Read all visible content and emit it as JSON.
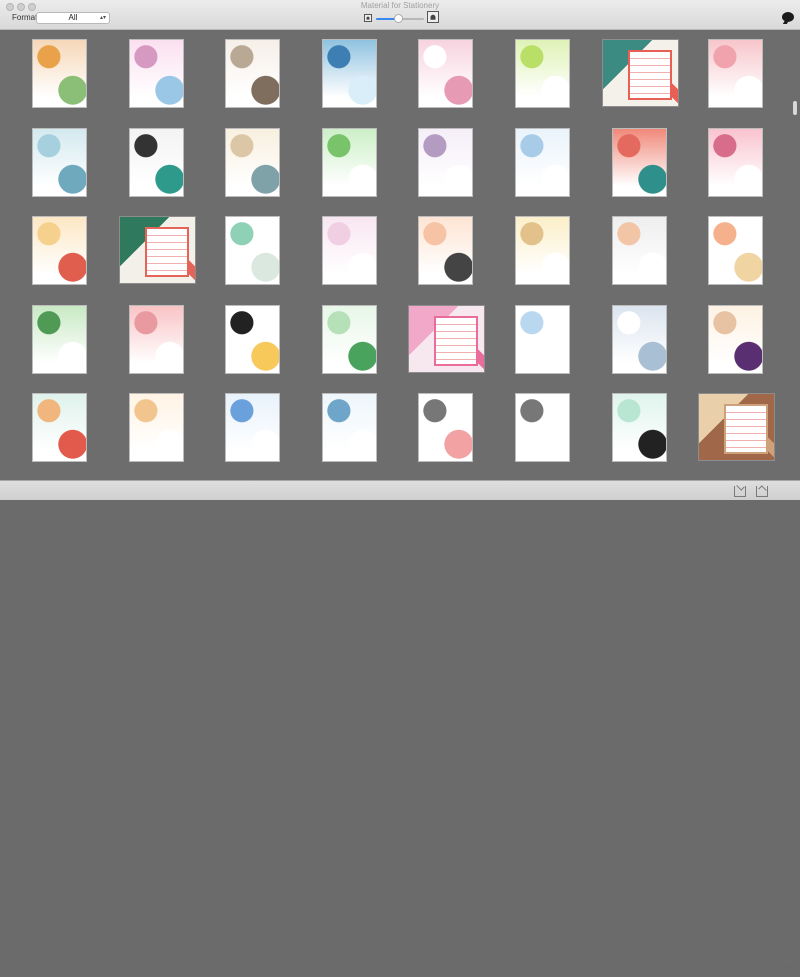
{
  "window": {
    "title": "Material for Stationery"
  },
  "toolbar": {
    "format_label": "Format:",
    "format_value": "All",
    "chat_icon": "chat-icon",
    "zoom_small_icon": "photo-small-icon",
    "zoom_large_icon": "photo-large-icon",
    "zoom_level": 0.45
  },
  "bottom_toolbar": {
    "icons": [
      "export-icon",
      "import-icon",
      "trash-icon"
    ]
  },
  "stationery": [
    {
      "id": 1,
      "theme": "floral-circle",
      "colors": [
        "#f6d7b7",
        "#e9a24a",
        "#8bbf77"
      ]
    },
    {
      "id": 2,
      "theme": "pink-floral-border",
      "colors": [
        "#fbe0f0",
        "#d69ac2",
        "#9bc7e6"
      ]
    },
    {
      "id": 3,
      "theme": "tea-pages",
      "colors": [
        "#f6efe8",
        "#b9a894",
        "#7f6d5d"
      ]
    },
    {
      "id": 4,
      "theme": "blue-strip",
      "colors": [
        "#8fc2e0",
        "#3d7fb3",
        "#d9eef9"
      ]
    },
    {
      "id": 5,
      "theme": "minimal-pink-dot",
      "colors": [
        "#f7d3df",
        "#ffffff",
        "#e69ab3"
      ]
    },
    {
      "id": 6,
      "theme": "green-daisies",
      "colors": [
        "#dff2b6",
        "#b9df67",
        "#ffffff"
      ]
    },
    {
      "id": 7,
      "theme": "teal-envelope",
      "colors": [
        "#3b8b82",
        "#e85f55",
        "#f4f0ea"
      ]
    },
    {
      "id": 8,
      "theme": "pink-blossom-corner",
      "colors": [
        "#f7c5cb",
        "#f0a2ad",
        "#ffffff"
      ]
    },
    {
      "id": 9,
      "theme": "sea-sky",
      "colors": [
        "#d3e9ef",
        "#a6d0de",
        "#6fa9be"
      ]
    },
    {
      "id": 10,
      "theme": "sketch-couple",
      "colors": [
        "#f3f3f3",
        "#333333",
        "#2e9a8b"
      ]
    },
    {
      "id": 11,
      "theme": "autumn-trees",
      "colors": [
        "#f8f0df",
        "#dbc7a6",
        "#7fa1a8"
      ]
    },
    {
      "id": 12,
      "theme": "green-vine-border",
      "colors": [
        "#ccefc7",
        "#79c36b",
        "#ffffff"
      ]
    },
    {
      "id": 13,
      "theme": "lavender-flowers",
      "colors": [
        "#f5eef8",
        "#b49bc2",
        "#ffffff"
      ]
    },
    {
      "id": 14,
      "theme": "blue-lined",
      "colors": [
        "#eaf3fb",
        "#a8cce8",
        "#ffffff"
      ]
    },
    {
      "id": 15,
      "theme": "salmon-block",
      "colors": [
        "#f0897a",
        "#e46a60",
        "#2f8f8a"
      ]
    },
    {
      "id": 16,
      "theme": "cherry-blossom",
      "colors": [
        "#f9c3cf",
        "#d76d8a",
        "#ffffff"
      ]
    },
    {
      "id": 17,
      "theme": "peach-lantern",
      "colors": [
        "#fde7c4",
        "#f6d08d",
        "#e05e4e"
      ]
    },
    {
      "id": 18,
      "theme": "green-envelope-card",
      "colors": [
        "#2f7a5e",
        "#e56458",
        "#f3f0ea"
      ]
    },
    {
      "id": 19,
      "theme": "minimal-green-flower",
      "colors": [
        "#ffffff",
        "#8fd1b6",
        "#dbe8e0"
      ]
    },
    {
      "id": 20,
      "theme": "pale-pink",
      "colors": [
        "#f8e6f1",
        "#f1cfe2",
        "#ffffff"
      ]
    },
    {
      "id": 21,
      "theme": "girl-umbrella",
      "colors": [
        "#fde4d3",
        "#f6c3a4",
        "#444444"
      ]
    },
    {
      "id": 22,
      "theme": "cream-frame",
      "colors": [
        "#fbefc9",
        "#e2c28a",
        "#ffffff"
      ]
    },
    {
      "id": 23,
      "theme": "pale-grey-blossom",
      "colors": [
        "#eeeeee",
        "#f2c5a6",
        "#ffffff"
      ]
    },
    {
      "id": 24,
      "theme": "autumn-leaves-bottom",
      "colors": [
        "#ffffff",
        "#f5b18b",
        "#f0d5a3"
      ]
    },
    {
      "id": 25,
      "theme": "green-scallop-border",
      "colors": [
        "#c8e9c3",
        "#4f9a55",
        "#ffffff"
      ]
    },
    {
      "id": 26,
      "theme": "pink-cartoon",
      "colors": [
        "#f9c3c5",
        "#e89aa0",
        "#ffffff"
      ]
    },
    {
      "id": 27,
      "theme": "branch-frame",
      "colors": [
        "#ffffff",
        "#222222",
        "#f7c95a"
      ]
    },
    {
      "id": 28,
      "theme": "green-gradient",
      "colors": [
        "#e7f7e8",
        "#b6e0b8",
        "#4aa35d"
      ]
    },
    {
      "id": 29,
      "theme": "pink-dots-envelope",
      "colors": [
        "#f2a9c9",
        "#e96c9b",
        "#f7e8ef"
      ]
    },
    {
      "id": 30,
      "theme": "white-blue-top",
      "colors": [
        "#ffffff",
        "#b9d7ef",
        "#ffffff"
      ]
    },
    {
      "id": 31,
      "theme": "dandelion-blue",
      "colors": [
        "#dbe4ef",
        "#ffffff",
        "#a9bfd3"
      ]
    },
    {
      "id": 32,
      "theme": "orchid-cream",
      "colors": [
        "#fdf2e3",
        "#e8c3a3",
        "#5a2f72"
      ]
    },
    {
      "id": 33,
      "theme": "mint-autumn",
      "colors": [
        "#dff2eb",
        "#f0b67e",
        "#e15a4b"
      ]
    },
    {
      "id": 34,
      "theme": "peach-lines",
      "colors": [
        "#fff3e4",
        "#f1c58d",
        "#ffffff"
      ]
    },
    {
      "id": 35,
      "theme": "blue-flowers",
      "colors": [
        "#e8f2fb",
        "#6aa1dc",
        "#ffffff"
      ]
    },
    {
      "id": 36,
      "theme": "sailboat-lines",
      "colors": [
        "#eef6fb",
        "#6ea5c8",
        "#ffffff"
      ]
    },
    {
      "id": 37,
      "theme": "city-sketch",
      "colors": [
        "#ffffff",
        "#777777",
        "#f2a2a2"
      ]
    },
    {
      "id": 38,
      "theme": "bird-corner",
      "colors": [
        "#ffffff",
        "#777777",
        "#ffffff"
      ]
    },
    {
      "id": 39,
      "theme": "mint-pen",
      "colors": [
        "#dff4ec",
        "#b8e6d3",
        "#222222"
      ]
    },
    {
      "id": 40,
      "theme": "vintage-bird",
      "colors": [
        "#e9cfaa",
        "#cfa17a",
        "#a06748"
      ]
    }
  ]
}
